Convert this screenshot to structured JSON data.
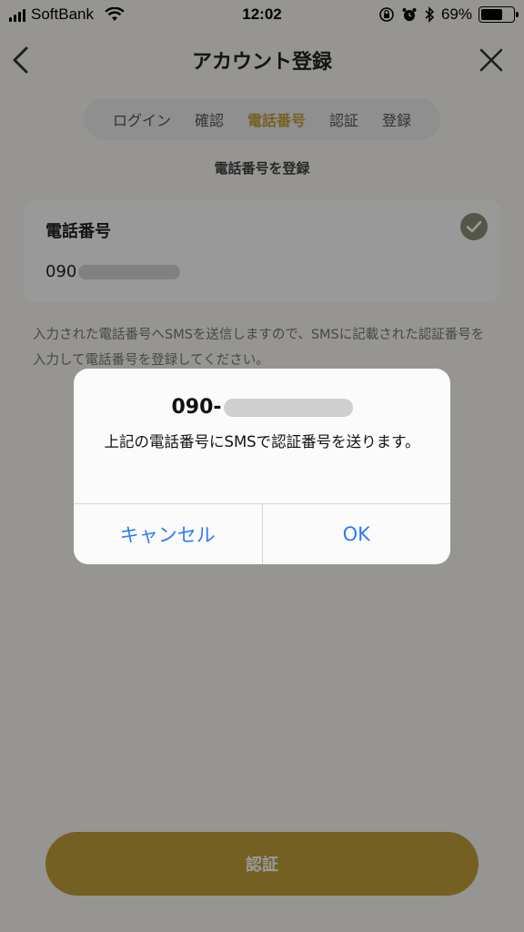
{
  "status_bar": {
    "carrier": "SoftBank",
    "time": "12:02",
    "battery_percent": "69%",
    "battery_level": 0.69
  },
  "nav": {
    "title": "アカウント登録",
    "back_icon": "chevron-left-icon",
    "close_icon": "close-icon"
  },
  "steps": {
    "items": [
      "ログイン",
      "確認",
      "電話番号",
      "認証",
      "登録"
    ],
    "active_index": 2,
    "active_color": "#c4a13b"
  },
  "section_label": "電話番号を登録",
  "phone_card": {
    "title": "電話番号",
    "value_prefix": "090",
    "check_color": "#8a8f7a"
  },
  "notice": "入力された電話番号へSMSを送信しますので、SMSに記載された認証番号を入力して電話番号を登録してください。",
  "primary_button": {
    "label": "認証",
    "color": "#c4a13b"
  },
  "alert": {
    "title_prefix": "090-",
    "message": "上記の電話番号にSMSで認証番号を送ります。",
    "cancel_label": "キャンセル",
    "ok_label": "OK",
    "action_color": "#2f7bf5"
  }
}
